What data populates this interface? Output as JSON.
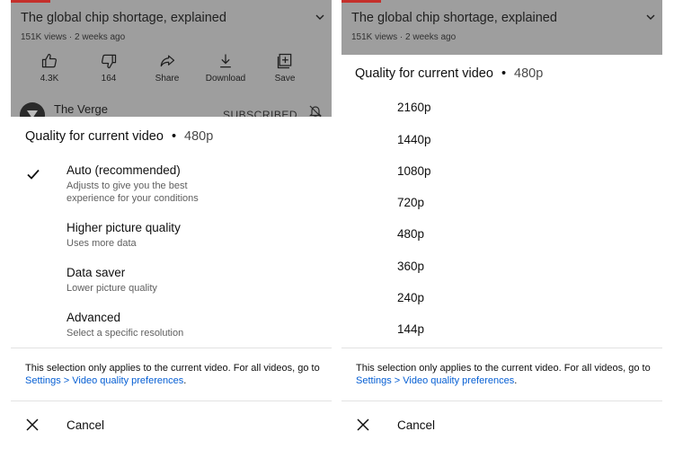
{
  "video": {
    "title": "The global chip shortage, explained",
    "meta": "151K views · 2 weeks ago"
  },
  "actions": [
    {
      "icon": "thumbs-up-icon",
      "label": "4.3K"
    },
    {
      "icon": "thumbs-down-icon",
      "label": "164"
    },
    {
      "icon": "share-icon",
      "label": "Share"
    },
    {
      "icon": "download-icon",
      "label": "Download"
    },
    {
      "icon": "save-icon",
      "label": "Save"
    }
  ],
  "channel": {
    "name": "The Verge",
    "subscribe_label": "SUBSCRIBED"
  },
  "sheet": {
    "title": "Quality for current video",
    "separator": "•",
    "current": "480p"
  },
  "quality_options": [
    {
      "label": "Auto (recommended)",
      "description": "Adjusts to give you the best experience for your conditions",
      "selected": true
    },
    {
      "label": "Higher picture quality",
      "description": "Uses more data",
      "selected": false
    },
    {
      "label": "Data saver",
      "description": "Lower picture quality",
      "selected": false
    },
    {
      "label": "Advanced",
      "description": "Select a specific resolution",
      "selected": false
    }
  ],
  "resolutions": [
    "2160p",
    "1440p",
    "1080p",
    "720p",
    "480p",
    "360p",
    "240p",
    "144p"
  ],
  "note": {
    "text": "This selection only applies to the current video. For all videos, go to ",
    "link": "Settings > Video quality preferences",
    "suffix": "."
  },
  "cancel_label": "Cancel",
  "colors": {
    "link": "#065fd4",
    "overlay": "#9e9e9e",
    "brand_red": "#c4302b"
  }
}
